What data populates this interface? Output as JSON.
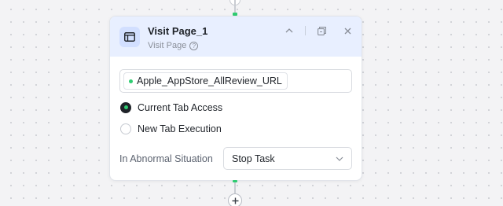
{
  "node": {
    "title": "Visit Page_1",
    "subtitle": "Visit Page",
    "icon": "browser-window-icon",
    "accent_color": "#e8efff"
  },
  "header_actions": {
    "collapse_icon": "chevron-up-icon",
    "copy_icon": "copy-icon",
    "close_icon": "close-icon"
  },
  "url_field": {
    "variable_name": "Apple_AppStore_AllReview_URL",
    "variable_status_color": "#2ecc71"
  },
  "tab_options": [
    {
      "label": "Current Tab Access",
      "selected": true
    },
    {
      "label": "New Tab Execution",
      "selected": false
    }
  ],
  "abnormal": {
    "label": "In Abnormal Situation",
    "selected_value": "Stop Task"
  },
  "connectors": {
    "add_icon": "plus-icon",
    "status_color": "#2ecc71"
  }
}
